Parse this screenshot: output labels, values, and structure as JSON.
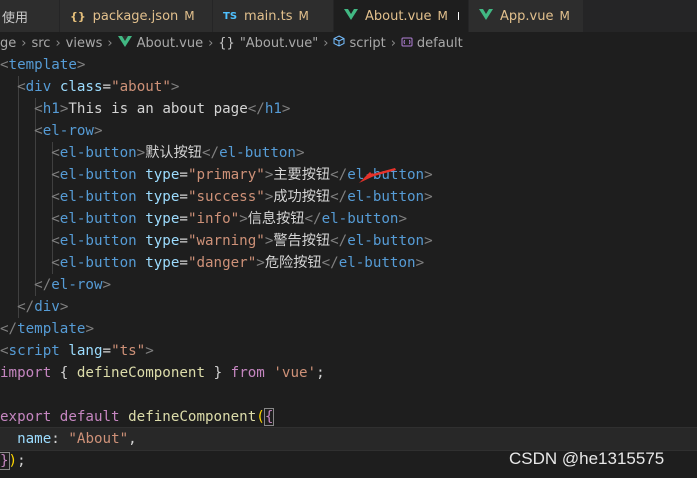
{
  "tabs": [
    {
      "label": "使用",
      "icon": "",
      "modified": "",
      "active": false
    },
    {
      "label": "package.json",
      "icon": "json-icon",
      "icon_text": "{}",
      "modified": "M",
      "active": false
    },
    {
      "label": "main.ts",
      "icon": "ts-icon",
      "icon_text": "TS",
      "modified": "M",
      "active": false
    },
    {
      "label": "About.vue",
      "icon": "vue-icon",
      "modified": "M",
      "active": true,
      "unsaved": true
    },
    {
      "label": "App.vue",
      "icon": "vue-icon",
      "modified": "M",
      "active": false
    }
  ],
  "breadcrumb": {
    "items": [
      "ge",
      "src",
      "views",
      "About.vue",
      "\"About.vue\"",
      "script",
      "default"
    ],
    "glyphs": {
      "braces": "{}"
    }
  },
  "code": {
    "lines": [
      "<template>",
      "  <div class=\"about\">",
      "    <h1>This is an about page</h1>",
      "    <el-row>",
      "      <el-button>默认按钮</el-button>",
      "      <el-button type=\"primary\">主要按钮</el-button>",
      "      <el-button type=\"success\">成功按钮</el-button>",
      "      <el-button type=\"info\">信息按钮</el-button>",
      "      <el-button type=\"warning\">警告按钮</el-button>",
      "      <el-button type=\"danger\">危险按钮</el-button>",
      "    </el-row>",
      "  </div>",
      "</template>",
      "<script lang=\"ts\">",
      "import { defineComponent } from 'vue';",
      "",
      "export default defineComponent({",
      "  name: \"About\",",
      "});"
    ]
  },
  "watermark": "CSDN @he1315575",
  "colors": {
    "background": "#1e1e1e",
    "tag": "#569cd6",
    "attribute": "#9cdcfe",
    "string": "#ce9178",
    "annotation_arrow": "#e8322a"
  }
}
